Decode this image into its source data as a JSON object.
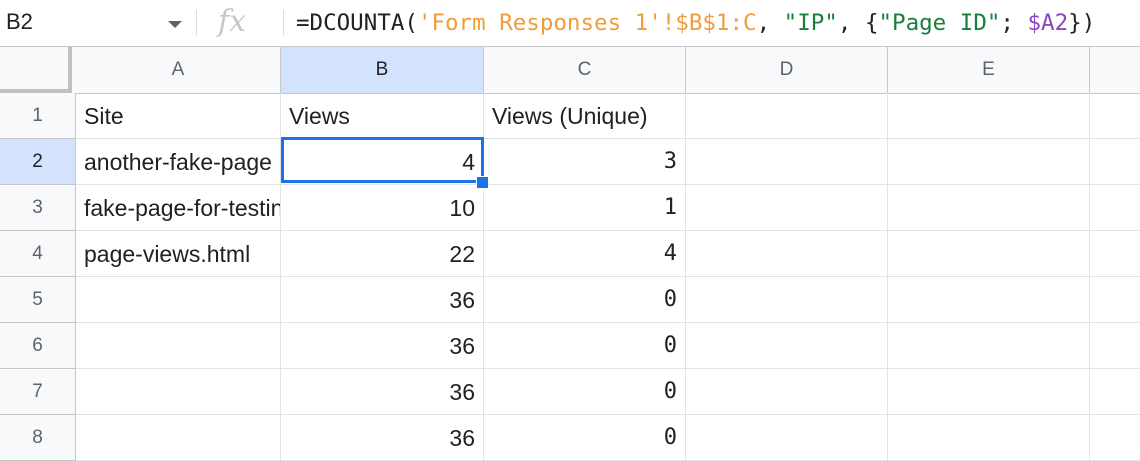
{
  "name_box": {
    "value": "B2"
  },
  "formula_bar": {
    "fx_label": "fx",
    "tokens": [
      {
        "text": "=DCOUNTA(",
        "kind": "func"
      },
      {
        "text": "'Form Responses 1'!$B$1:C",
        "kind": "range"
      },
      {
        "text": ", ",
        "kind": "func"
      },
      {
        "text": "\"IP\"",
        "kind": "str"
      },
      {
        "text": ", {",
        "kind": "func"
      },
      {
        "text": "\"Page ID\"",
        "kind": "str"
      },
      {
        "text": "; ",
        "kind": "func"
      },
      {
        "text": "$A2",
        "kind": "ref"
      },
      {
        "text": "})",
        "kind": "func"
      }
    ]
  },
  "columns": [
    "A",
    "B",
    "C",
    "D",
    "E"
  ],
  "selected_column": "B",
  "selected_row": "2",
  "rows": [
    {
      "n": "1",
      "A": "Site",
      "B": "Views",
      "C": "Views (Unique)",
      "D": "",
      "E": ""
    },
    {
      "n": "2",
      "A": "another-fake-page",
      "B": "4",
      "C": "3",
      "D": "",
      "E": ""
    },
    {
      "n": "3",
      "A": "fake-page-for-testing",
      "B": "10",
      "C": "1",
      "D": "",
      "E": ""
    },
    {
      "n": "4",
      "A": "page-views.html",
      "B": "22",
      "C": "4",
      "D": "",
      "E": ""
    },
    {
      "n": "5",
      "A": "",
      "B": "36",
      "C": "0",
      "D": "",
      "E": ""
    },
    {
      "n": "6",
      "A": "",
      "B": "36",
      "C": "0",
      "D": "",
      "E": ""
    },
    {
      "n": "7",
      "A": "",
      "B": "36",
      "C": "0",
      "D": "",
      "E": ""
    },
    {
      "n": "8",
      "A": "",
      "B": "36",
      "C": "0",
      "D": "",
      "E": ""
    }
  ],
  "colors": {
    "selection": "#1a73e8",
    "header_selected": "#d3e3fd"
  }
}
